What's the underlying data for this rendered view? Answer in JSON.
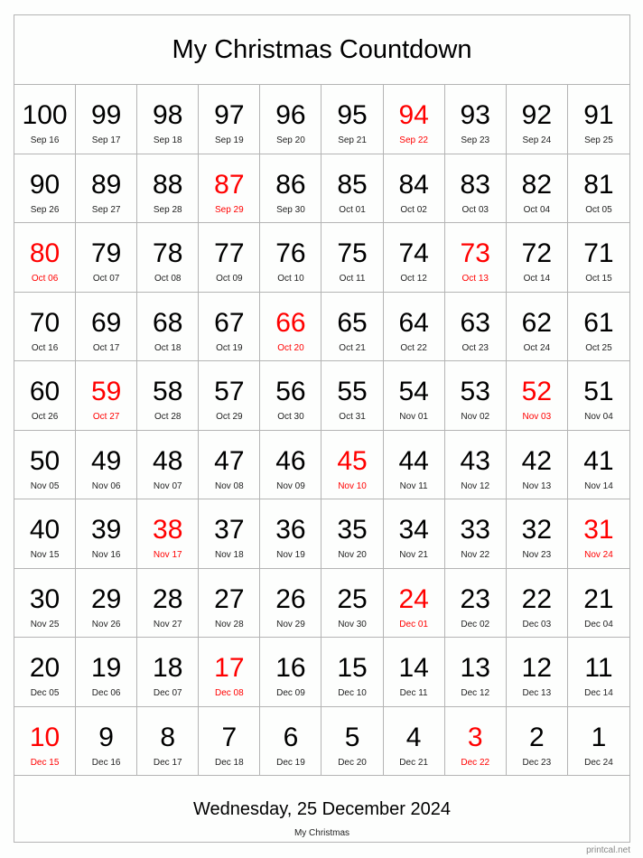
{
  "title": "My Christmas Countdown",
  "accent_color": "#ff0000",
  "days": [
    {
      "n": "100",
      "d": "Sep 16",
      "red": false
    },
    {
      "n": "99",
      "d": "Sep 17",
      "red": false
    },
    {
      "n": "98",
      "d": "Sep 18",
      "red": false
    },
    {
      "n": "97",
      "d": "Sep 19",
      "red": false
    },
    {
      "n": "96",
      "d": "Sep 20",
      "red": false
    },
    {
      "n": "95",
      "d": "Sep 21",
      "red": false
    },
    {
      "n": "94",
      "d": "Sep 22",
      "red": true
    },
    {
      "n": "93",
      "d": "Sep 23",
      "red": false
    },
    {
      "n": "92",
      "d": "Sep 24",
      "red": false
    },
    {
      "n": "91",
      "d": "Sep 25",
      "red": false
    },
    {
      "n": "90",
      "d": "Sep 26",
      "red": false
    },
    {
      "n": "89",
      "d": "Sep 27",
      "red": false
    },
    {
      "n": "88",
      "d": "Sep 28",
      "red": false
    },
    {
      "n": "87",
      "d": "Sep 29",
      "red": true
    },
    {
      "n": "86",
      "d": "Sep 30",
      "red": false
    },
    {
      "n": "85",
      "d": "Oct 01",
      "red": false
    },
    {
      "n": "84",
      "d": "Oct 02",
      "red": false
    },
    {
      "n": "83",
      "d": "Oct 03",
      "red": false
    },
    {
      "n": "82",
      "d": "Oct 04",
      "red": false
    },
    {
      "n": "81",
      "d": "Oct 05",
      "red": false
    },
    {
      "n": "80",
      "d": "Oct 06",
      "red": true
    },
    {
      "n": "79",
      "d": "Oct 07",
      "red": false
    },
    {
      "n": "78",
      "d": "Oct 08",
      "red": false
    },
    {
      "n": "77",
      "d": "Oct 09",
      "red": false
    },
    {
      "n": "76",
      "d": "Oct 10",
      "red": false
    },
    {
      "n": "75",
      "d": "Oct 11",
      "red": false
    },
    {
      "n": "74",
      "d": "Oct 12",
      "red": false
    },
    {
      "n": "73",
      "d": "Oct 13",
      "red": true
    },
    {
      "n": "72",
      "d": "Oct 14",
      "red": false
    },
    {
      "n": "71",
      "d": "Oct 15",
      "red": false
    },
    {
      "n": "70",
      "d": "Oct 16",
      "red": false
    },
    {
      "n": "69",
      "d": "Oct 17",
      "red": false
    },
    {
      "n": "68",
      "d": "Oct 18",
      "red": false
    },
    {
      "n": "67",
      "d": "Oct 19",
      "red": false
    },
    {
      "n": "66",
      "d": "Oct 20",
      "red": true
    },
    {
      "n": "65",
      "d": "Oct 21",
      "red": false
    },
    {
      "n": "64",
      "d": "Oct 22",
      "red": false
    },
    {
      "n": "63",
      "d": "Oct 23",
      "red": false
    },
    {
      "n": "62",
      "d": "Oct 24",
      "red": false
    },
    {
      "n": "61",
      "d": "Oct 25",
      "red": false
    },
    {
      "n": "60",
      "d": "Oct 26",
      "red": false
    },
    {
      "n": "59",
      "d": "Oct 27",
      "red": true
    },
    {
      "n": "58",
      "d": "Oct 28",
      "red": false
    },
    {
      "n": "57",
      "d": "Oct 29",
      "red": false
    },
    {
      "n": "56",
      "d": "Oct 30",
      "red": false
    },
    {
      "n": "55",
      "d": "Oct 31",
      "red": false
    },
    {
      "n": "54",
      "d": "Nov 01",
      "red": false
    },
    {
      "n": "53",
      "d": "Nov 02",
      "red": false
    },
    {
      "n": "52",
      "d": "Nov 03",
      "red": true
    },
    {
      "n": "51",
      "d": "Nov 04",
      "red": false
    },
    {
      "n": "50",
      "d": "Nov 05",
      "red": false
    },
    {
      "n": "49",
      "d": "Nov 06",
      "red": false
    },
    {
      "n": "48",
      "d": "Nov 07",
      "red": false
    },
    {
      "n": "47",
      "d": "Nov 08",
      "red": false
    },
    {
      "n": "46",
      "d": "Nov 09",
      "red": false
    },
    {
      "n": "45",
      "d": "Nov 10",
      "red": true
    },
    {
      "n": "44",
      "d": "Nov 11",
      "red": false
    },
    {
      "n": "43",
      "d": "Nov 12",
      "red": false
    },
    {
      "n": "42",
      "d": "Nov 13",
      "red": false
    },
    {
      "n": "41",
      "d": "Nov 14",
      "red": false
    },
    {
      "n": "40",
      "d": "Nov 15",
      "red": false
    },
    {
      "n": "39",
      "d": "Nov 16",
      "red": false
    },
    {
      "n": "38",
      "d": "Nov 17",
      "red": true
    },
    {
      "n": "37",
      "d": "Nov 18",
      "red": false
    },
    {
      "n": "36",
      "d": "Nov 19",
      "red": false
    },
    {
      "n": "35",
      "d": "Nov 20",
      "red": false
    },
    {
      "n": "34",
      "d": "Nov 21",
      "red": false
    },
    {
      "n": "33",
      "d": "Nov 22",
      "red": false
    },
    {
      "n": "32",
      "d": "Nov 23",
      "red": false
    },
    {
      "n": "31",
      "d": "Nov 24",
      "red": true
    },
    {
      "n": "30",
      "d": "Nov 25",
      "red": false
    },
    {
      "n": "29",
      "d": "Nov 26",
      "red": false
    },
    {
      "n": "28",
      "d": "Nov 27",
      "red": false
    },
    {
      "n": "27",
      "d": "Nov 28",
      "red": false
    },
    {
      "n": "26",
      "d": "Nov 29",
      "red": false
    },
    {
      "n": "25",
      "d": "Nov 30",
      "red": false
    },
    {
      "n": "24",
      "d": "Dec 01",
      "red": true
    },
    {
      "n": "23",
      "d": "Dec 02",
      "red": false
    },
    {
      "n": "22",
      "d": "Dec 03",
      "red": false
    },
    {
      "n": "21",
      "d": "Dec 04",
      "red": false
    },
    {
      "n": "20",
      "d": "Dec 05",
      "red": false
    },
    {
      "n": "19",
      "d": "Dec 06",
      "red": false
    },
    {
      "n": "18",
      "d": "Dec 07",
      "red": false
    },
    {
      "n": "17",
      "d": "Dec 08",
      "red": true
    },
    {
      "n": "16",
      "d": "Dec 09",
      "red": false
    },
    {
      "n": "15",
      "d": "Dec 10",
      "red": false
    },
    {
      "n": "14",
      "d": "Dec 11",
      "red": false
    },
    {
      "n": "13",
      "d": "Dec 12",
      "red": false
    },
    {
      "n": "12",
      "d": "Dec 13",
      "red": false
    },
    {
      "n": "11",
      "d": "Dec 14",
      "red": false
    },
    {
      "n": "10",
      "d": "Dec 15",
      "red": true
    },
    {
      "n": "9",
      "d": "Dec 16",
      "red": false
    },
    {
      "n": "8",
      "d": "Dec 17",
      "red": false
    },
    {
      "n": "7",
      "d": "Dec 18",
      "red": false
    },
    {
      "n": "6",
      "d": "Dec 19",
      "red": false
    },
    {
      "n": "5",
      "d": "Dec 20",
      "red": false
    },
    {
      "n": "4",
      "d": "Dec 21",
      "red": false
    },
    {
      "n": "3",
      "d": "Dec 22",
      "red": true
    },
    {
      "n": "2",
      "d": "Dec 23",
      "red": false
    },
    {
      "n": "1",
      "d": "Dec 24",
      "red": false
    }
  ],
  "footer": {
    "event_date": "Wednesday, 25 December 2024",
    "event_name": "My Christmas"
  },
  "credit": "printcal.net"
}
